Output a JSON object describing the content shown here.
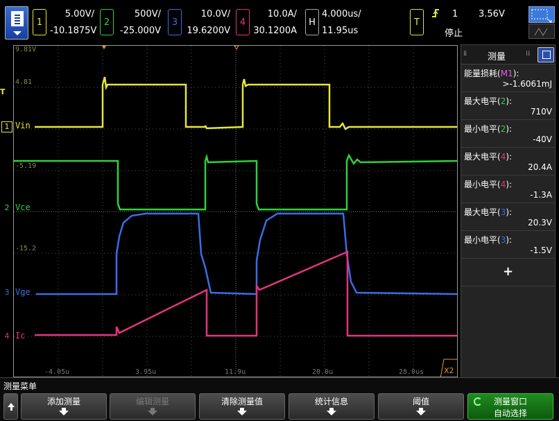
{
  "channels": [
    {
      "num": "1",
      "scale": "5.00V/",
      "offset": "-10.1875V",
      "color": "#e6e63c"
    },
    {
      "num": "2",
      "scale": "500V/",
      "offset": "-25.000V",
      "color": "#2fd23a"
    },
    {
      "num": "3",
      "scale": "10.0V/",
      "offset": "19.6200V",
      "color": "#3b6de8"
    },
    {
      "num": "4",
      "scale": "10.0A/",
      "offset": "30.1200A",
      "color": "#e23580"
    }
  ],
  "horizontal": {
    "tag": "H",
    "scale": "4.000us/",
    "delay": "11.95us"
  },
  "trigger": {
    "tag": "T",
    "icon": "rising-edge-icon",
    "source": "1",
    "level": "3.56V",
    "status": "停止"
  },
  "screen": {
    "left_marker_T": "T",
    "traces": {
      "ch1": {
        "label": "Vin",
        "marker": "1"
      },
      "ch2": {
        "label": "Vce",
        "marker": "2"
      },
      "ch3": {
        "label": "Vge",
        "marker": "3"
      },
      "ch4": {
        "label": "Ic",
        "marker": "4"
      }
    },
    "grid_labels": [
      "9.81V",
      "4.81",
      "-5.19",
      "-15.2"
    ],
    "time_labels": [
      "-4.05u",
      "3.95u",
      "11.9u",
      "20.0u",
      "28.0us"
    ],
    "zoom_badge": "X2"
  },
  "panel": {
    "title": "测量",
    "items": [
      {
        "name": "能量损耗",
        "src": "M1",
        "src_color": "#e060e0",
        "value": ">-1.6061mJ"
      },
      {
        "name": "最大电平",
        "src": "2",
        "src_color": "#2fd23a",
        "value": "710V"
      },
      {
        "name": "最小电平",
        "src": "2",
        "src_color": "#2fd23a",
        "value": "-40V"
      },
      {
        "name": "最大电平",
        "src": "4",
        "src_color": "#e23580",
        "value": "20.4A"
      },
      {
        "name": "最小电平",
        "src": "4",
        "src_color": "#e23580",
        "value": "-1.3A"
      },
      {
        "name": "最大电平",
        "src": "3",
        "src_color": "#3b6de8",
        "value": "20.3V"
      },
      {
        "name": "最小电平",
        "src": "3",
        "src_color": "#3b6de8",
        "value": "-1.5V"
      }
    ],
    "add": "+"
  },
  "bottom": {
    "menu_label": "测量菜单",
    "softkeys": [
      {
        "label": "添加测量",
        "enabled": true
      },
      {
        "label": "编辑测量",
        "enabled": false
      },
      {
        "label": "清除测量值",
        "enabled": true
      },
      {
        "label": "统计信息",
        "enabled": true
      },
      {
        "label": "阈值",
        "enabled": true
      }
    ],
    "window": {
      "label": "测量窗口",
      "sub": "自动选择"
    }
  }
}
